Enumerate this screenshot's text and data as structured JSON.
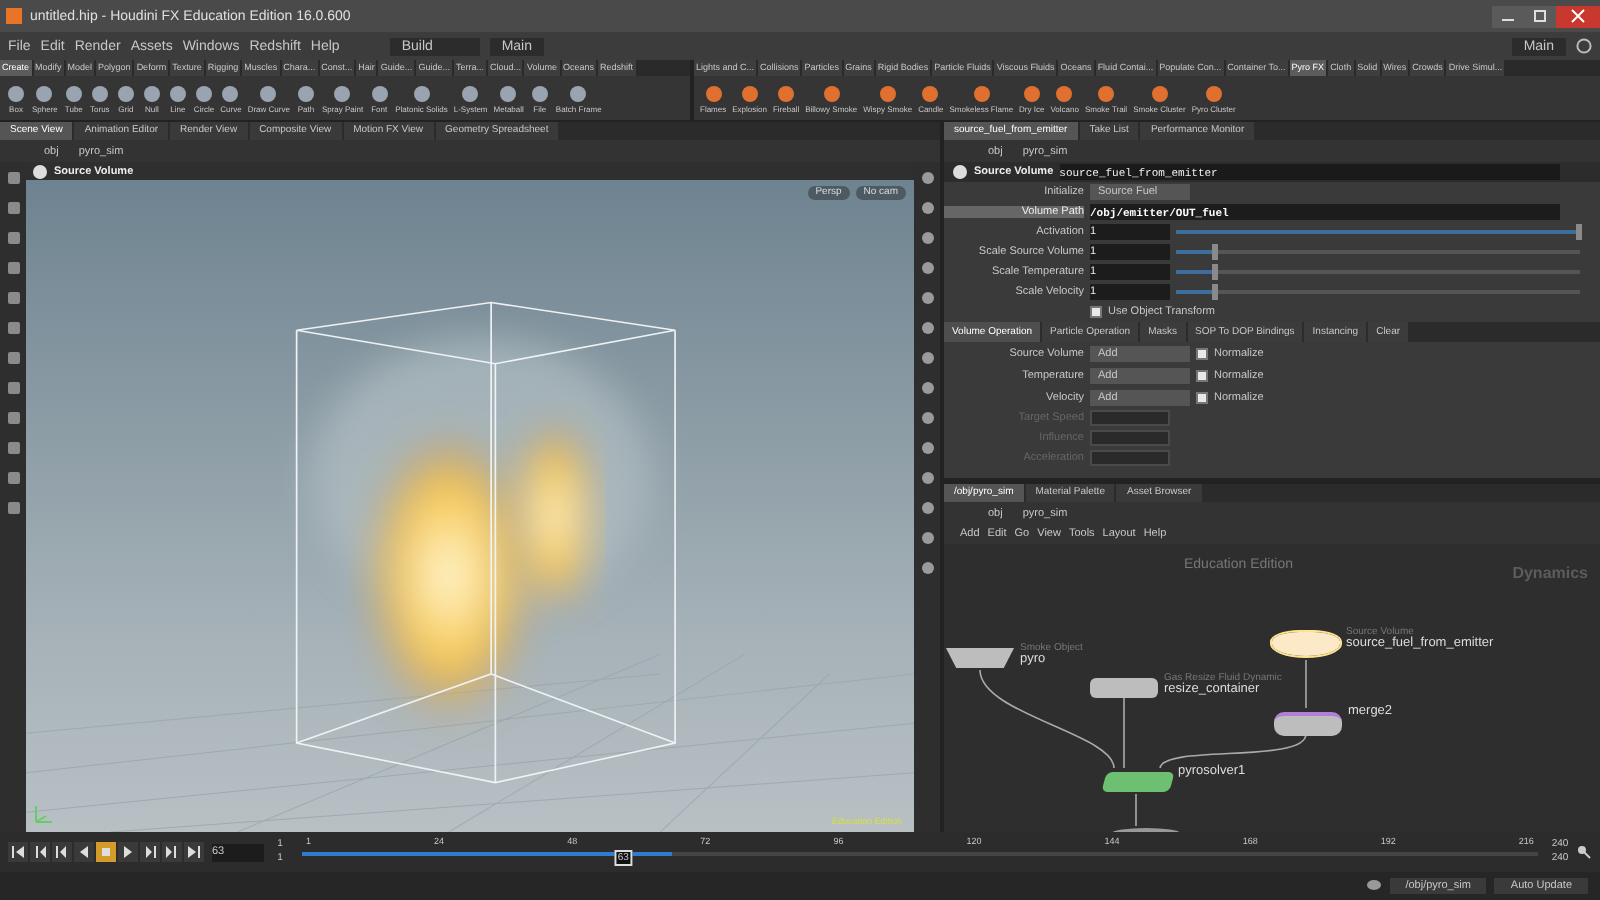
{
  "window": {
    "title": "untitled.hip - Houdini FX Education Edition 16.0.600"
  },
  "menu": [
    "File",
    "Edit",
    "Render",
    "Assets",
    "Windows",
    "Redshift",
    "Help"
  ],
  "desktop": {
    "label": "Build"
  },
  "layout": {
    "label": "Main"
  },
  "right_desktop": {
    "label": "Main"
  },
  "shelf_left": {
    "tabs": [
      {
        "label": "Create",
        "selected": true
      },
      {
        "label": "Modify",
        "selected": false
      },
      {
        "label": "Model",
        "selected": false
      },
      {
        "label": "Polygon",
        "selected": false
      },
      {
        "label": "Deform",
        "selected": false
      },
      {
        "label": "Texture",
        "selected": false
      },
      {
        "label": "Rigging",
        "selected": false
      },
      {
        "label": "Muscles",
        "selected": false
      },
      {
        "label": "Chara...",
        "selected": false
      },
      {
        "label": "Const...",
        "selected": false
      },
      {
        "label": "Hair",
        "selected": false
      },
      {
        "label": "Guide...",
        "selected": false
      },
      {
        "label": "Guide...",
        "selected": false
      },
      {
        "label": "Terra...",
        "selected": false
      },
      {
        "label": "Cloud...",
        "selected": false
      },
      {
        "label": "Volume",
        "selected": false
      },
      {
        "label": "Oceans",
        "selected": false
      },
      {
        "label": "Redshift",
        "selected": false
      }
    ],
    "tools": [
      "Box",
      "Sphere",
      "Tube",
      "Torus",
      "Grid",
      "Null",
      "Line",
      "Circle",
      "Curve",
      "Draw Curve",
      "Path",
      "Spray Paint",
      "Font",
      "Platonic Solids",
      "L-System",
      "Metaball",
      "File",
      "Batch Frame"
    ]
  },
  "shelf_right": {
    "tabs": [
      {
        "label": "Lights and C...",
        "selected": false
      },
      {
        "label": "Collisions",
        "selected": false
      },
      {
        "label": "Particles",
        "selected": false
      },
      {
        "label": "Grains",
        "selected": false
      },
      {
        "label": "Rigid Bodies",
        "selected": false
      },
      {
        "label": "Particle Fluids",
        "selected": false
      },
      {
        "label": "Viscous Fluids",
        "selected": false
      },
      {
        "label": "Oceans",
        "selected": false
      },
      {
        "label": "Fluid Contai...",
        "selected": false
      },
      {
        "label": "Populate Con...",
        "selected": false
      },
      {
        "label": "Container To...",
        "selected": false
      },
      {
        "label": "Pyro FX",
        "selected": true
      },
      {
        "label": "Cloth",
        "selected": false
      },
      {
        "label": "Solid",
        "selected": false
      },
      {
        "label": "Wires",
        "selected": false
      },
      {
        "label": "Crowds",
        "selected": false
      },
      {
        "label": "Drive Simul...",
        "selected": false
      }
    ],
    "tools": [
      "Flames",
      "Explosion",
      "Fireball",
      "Billowy Smoke",
      "Wispy Smoke",
      "Candle",
      "Smokeless Flame",
      "Dry Ice",
      "Volcano",
      "Smoke Trail",
      "Smoke Cluster",
      "Pyro Cluster"
    ]
  },
  "scene_pane": {
    "tabs": [
      {
        "label": "Scene View",
        "selected": true
      },
      {
        "label": "Animation Editor",
        "selected": false
      },
      {
        "label": "Render View",
        "selected": false
      },
      {
        "label": "Composite View",
        "selected": false
      },
      {
        "label": "Motion FX View",
        "selected": false
      },
      {
        "label": "Geometry Spreadsheet",
        "selected": false
      }
    ],
    "path": [
      "obj",
      "pyro_sim"
    ],
    "viewport": {
      "title": "Source Volume",
      "menus": [
        "Persp",
        "No cam"
      ],
      "edition_label": "Education Edition"
    }
  },
  "parameter_pane": {
    "tabs": [
      {
        "label": "source_fuel_from_emitter",
        "selected": true
      },
      {
        "label": "Take List",
        "selected": false
      },
      {
        "label": "Performance Monitor",
        "selected": false
      }
    ],
    "path": [
      "obj",
      "pyro_sim"
    ],
    "node_type": "Source Volume",
    "node_name": "source_fuel_from_emitter",
    "initialize": {
      "label": "Initialize",
      "value": "Source Fuel"
    },
    "volume_path": {
      "label": "Volume Path",
      "value": "/obj/emitter/OUT_fuel"
    },
    "sliders": [
      {
        "label": "Activation",
        "value": "1",
        "level": 1
      },
      {
        "label": "Scale Source Volume",
        "value": "1",
        "level": 0.1
      },
      {
        "label": "Scale Temperature",
        "value": "1",
        "level": 0.1
      },
      {
        "label": "Scale Velocity",
        "value": "1",
        "level": 0.1
      }
    ],
    "use_object_transform": {
      "label": "Use Object Transform",
      "checked": true
    },
    "sections": [
      {
        "label": "Volume Operation",
        "selected": true
      },
      {
        "label": "Particle Operation",
        "selected": false
      },
      {
        "label": "Masks",
        "selected": false
      },
      {
        "label": "SOP To DOP Bindings",
        "selected": false
      },
      {
        "label": "Instancing",
        "selected": false
      },
      {
        "label": "Clear",
        "selected": false
      }
    ],
    "operations": [
      {
        "label": "Source Volume",
        "value": "Add",
        "option": "Normalize",
        "checked": true
      },
      {
        "label": "Temperature",
        "value": "Add",
        "option": "Normalize",
        "checked": true
      },
      {
        "label": "Velocity",
        "value": "Add",
        "option": "Normalize",
        "checked": true
      }
    ],
    "disabled_fields": [
      "Target Speed",
      "Influence",
      "Acceleration"
    ]
  },
  "network_pane": {
    "tabs": [
      {
        "label": "/obj/pyro_sim",
        "selected": true
      },
      {
        "label": "Material Palette",
        "selected": false
      },
      {
        "label": "Asset Browser",
        "selected": false
      }
    ],
    "path": [
      "obj",
      "pyro_sim"
    ],
    "menu": [
      "Add",
      "Edit",
      "Go",
      "View",
      "Tools",
      "Layout",
      "Help"
    ],
    "edition_label": "Education Edition",
    "context": "Dynamics",
    "nodes": [
      {
        "kind": "object",
        "type": "Smoke Object",
        "name": "pyro",
        "selected": false
      },
      {
        "kind": "dop",
        "type": "Gas Resize Fluid Dynamic",
        "name": "resize_container",
        "selected": false
      },
      {
        "kind": "source",
        "type": "Source Volume",
        "name": "source_fuel_from_emitter",
        "selected": true
      },
      {
        "kind": "merge",
        "name": "merge2",
        "selected": false
      },
      {
        "kind": "solver",
        "name": "pyrosolver1",
        "selected": false
      },
      {
        "kind": "output",
        "selected": false
      }
    ]
  },
  "timeline": {
    "transport": [
      {
        "kind": "first",
        "selected": false
      },
      {
        "kind": "prevkey",
        "selected": false
      },
      {
        "kind": "stepback",
        "selected": false
      },
      {
        "kind": "reverse",
        "selected": false
      },
      {
        "kind": "stop",
        "selected": true
      },
      {
        "kind": "play",
        "selected": false
      },
      {
        "kind": "stepfwd",
        "selected": false
      },
      {
        "kind": "nextkey",
        "selected": false
      },
      {
        "kind": "last",
        "selected": false
      }
    ],
    "frame": "63",
    "start": [
      "1",
      "1"
    ],
    "end": [
      "240",
      "240"
    ],
    "ticks": [
      "1",
      "24",
      "48",
      "72",
      "96",
      "120",
      "144",
      "168",
      "192",
      "216"
    ],
    "cache": {
      "level": 0.3
    },
    "playhead": {
      "label": "63",
      "level": 0.26
    }
  },
  "status_bar": {
    "path": "/obj/pyro_sim",
    "update_mode": "Auto Update"
  }
}
